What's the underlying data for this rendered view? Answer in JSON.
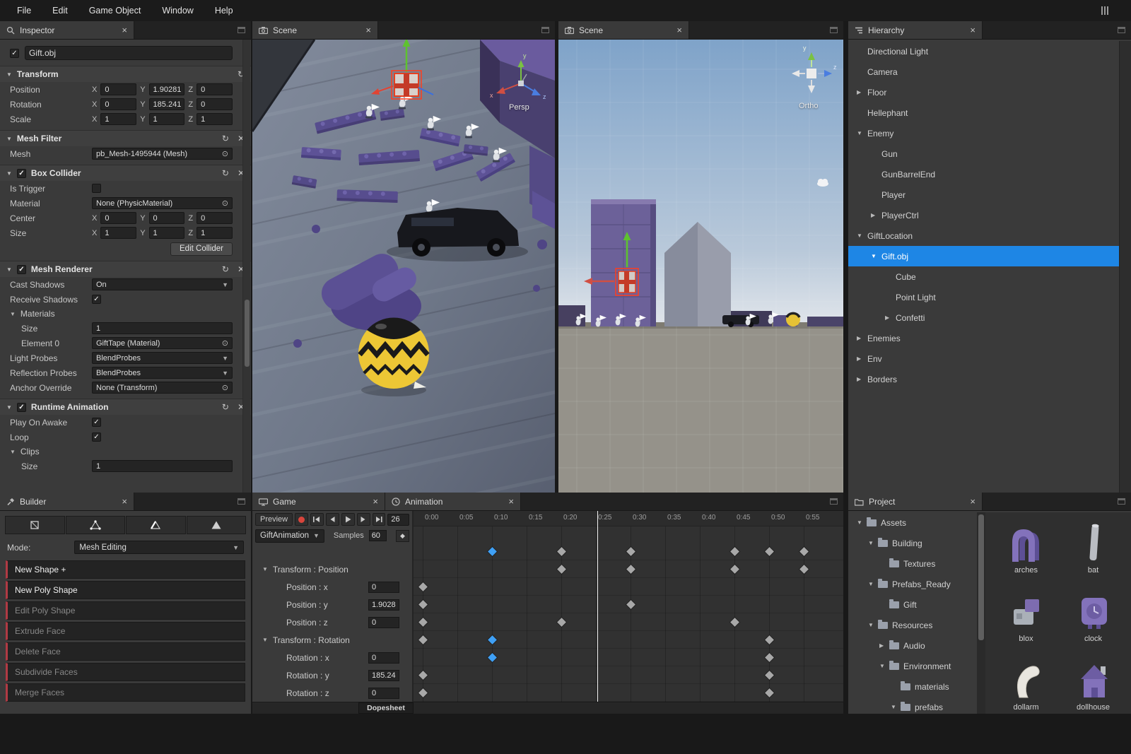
{
  "colors": {
    "accent_blue": "#1e86e5",
    "builder_red": "#b03a44",
    "record_red": "#d9453c",
    "keyframe_blue": "#3fa0f5",
    "panel_bg": "#3a3a3a"
  },
  "menubar": {
    "items": [
      "File",
      "Edit",
      "Game Object",
      "Window",
      "Help"
    ]
  },
  "inspector": {
    "tab": "Inspector",
    "name": "Gift.obj",
    "axes": {
      "x": "X",
      "y": "Y",
      "z": "Z"
    },
    "transform": {
      "title": "Transform",
      "position": "Position",
      "rotation": "Rotation",
      "scale": "Scale",
      "pos": {
        "x": "0",
        "y": "1.90281",
        "z": "0"
      },
      "rot": {
        "x": "0",
        "y": "185.241",
        "z": "0"
      },
      "scl": {
        "x": "1",
        "y": "1",
        "z": "1"
      }
    },
    "meshfilter": {
      "title": "Mesh Filter",
      "mesh": "Mesh",
      "mesh_value": "pb_Mesh-1495944 (Mesh)"
    },
    "boxcollider": {
      "title": "Box Collider",
      "is_trigger": "Is Trigger",
      "material": "Material",
      "material_value": "None (PhysicMaterial)",
      "center": "Center",
      "size": "Size",
      "center_v": {
        "x": "0",
        "y": "0",
        "z": "0"
      },
      "size_v": {
        "x": "1",
        "y": "1",
        "z": "1"
      },
      "edit": "Edit Collider"
    },
    "meshrenderer": {
      "title": "Mesh Renderer",
      "cast": "Cast Shadows",
      "cast_value": "On",
      "receive": "Receive Shadows",
      "materials": "Materials",
      "msize": "Size",
      "msize_value": "1",
      "el0": "Element 0",
      "el0_value": "GiftTape (Material)",
      "light": "Light Probes",
      "light_value": "BlendProbes",
      "refl": "Reflection Probes",
      "refl_value": "BlendProbes",
      "anchor": "Anchor Override",
      "anchor_value": "None (Transform)"
    },
    "runtimeanim": {
      "title": "Runtime Animation",
      "poa": "Play On Awake",
      "loop": "Loop",
      "clips": "Clips",
      "csize": "Size",
      "csize_value": "1"
    }
  },
  "scene1": {
    "tab": "Scene",
    "gizmo_label": "Persp",
    "axis_x": "x",
    "axis_y": "y",
    "axis_z": "z"
  },
  "scene2": {
    "tab": "Scene",
    "gizmo_label": "Ortho",
    "axis_y": "y",
    "axis_z": "z"
  },
  "hierarchy": {
    "tab": "Hierarchy",
    "items": [
      {
        "label": "Directional Light",
        "indent": 0,
        "arrow": ""
      },
      {
        "label": "Camera",
        "indent": 0,
        "arrow": ""
      },
      {
        "label": "Floor",
        "indent": 0,
        "arrow": "right"
      },
      {
        "label": "Hellephant",
        "indent": 0,
        "arrow": ""
      },
      {
        "label": "Enemy",
        "indent": 0,
        "arrow": "down"
      },
      {
        "label": "Gun",
        "indent": 1,
        "arrow": ""
      },
      {
        "label": "GunBarrelEnd",
        "indent": 1,
        "arrow": ""
      },
      {
        "label": "Player",
        "indent": 1,
        "arrow": ""
      },
      {
        "label": "PlayerCtrl",
        "indent": 1,
        "arrow": "right"
      },
      {
        "label": "GiftLocation",
        "indent": 0,
        "arrow": "down"
      },
      {
        "label": "Gift.obj",
        "indent": 1,
        "arrow": "down",
        "selected": true
      },
      {
        "label": "Cube",
        "indent": 2,
        "arrow": ""
      },
      {
        "label": "Point Light",
        "indent": 2,
        "arrow": ""
      },
      {
        "label": "Confetti",
        "indent": 2,
        "arrow": "right"
      },
      {
        "label": "Enemies",
        "indent": 0,
        "arrow": "right"
      },
      {
        "label": "Env",
        "indent": 0,
        "arrow": "right"
      },
      {
        "label": "Borders",
        "indent": 0,
        "arrow": "right"
      }
    ]
  },
  "builder": {
    "tab": "Builder",
    "mode_label": "Mode:",
    "mode_value": "Mesh Editing",
    "actions": [
      {
        "label": "New Shape  +",
        "enabled": true
      },
      {
        "label": "New Poly Shape",
        "enabled": true
      },
      {
        "label": "Edit Poly Shape",
        "enabled": false
      },
      {
        "label": "Extrude Face",
        "enabled": false
      },
      {
        "label": "Delete Face",
        "enabled": false
      },
      {
        "label": "Subdivide Faces",
        "enabled": false
      },
      {
        "label": "Merge Faces",
        "enabled": false
      }
    ]
  },
  "game": {
    "tab": "Game"
  },
  "animation": {
    "tab": "Animation",
    "preview_label": "Preview",
    "frame": "26",
    "clip_name": "GiftAnimation",
    "samples_label": "Samples",
    "samples_value": "60",
    "dopesheet_label": "Dopesheet",
    "properties": [
      {
        "label": "Transform : Position",
        "group": true
      },
      {
        "label": "Position : x",
        "value": "0"
      },
      {
        "label": "Position : y",
        "value": "1.9028"
      },
      {
        "label": "Position : z",
        "value": "0"
      },
      {
        "label": "Transform : Rotation",
        "group": true
      },
      {
        "label": "Rotation : x",
        "value": "0"
      },
      {
        "label": "Rotation : y",
        "value": "185.24"
      },
      {
        "label": "Rotation : z",
        "value": "0"
      }
    ],
    "ruler": [
      "0:00",
      "0:05",
      "0:10",
      "0:15",
      "0:20",
      "0:25",
      "0:30",
      "0:35",
      "0:40",
      "0:45",
      "0:50",
      "0:55"
    ],
    "playhead_seconds": 25.2,
    "tracks": [
      {
        "keys": [
          [
            10,
            1
          ],
          [
            20,
            0
          ],
          [
            30,
            0
          ],
          [
            45,
            0
          ],
          [
            50,
            0
          ],
          [
            55,
            0
          ]
        ]
      },
      {
        "keys": [
          [
            20,
            0
          ],
          [
            30,
            0
          ],
          [
            45,
            0
          ],
          [
            55,
            0
          ]
        ]
      },
      {
        "keys": [
          [
            0,
            0
          ]
        ]
      },
      {
        "keys": [
          [
            0,
            0
          ],
          [
            30,
            0
          ]
        ]
      },
      {
        "keys": [
          [
            0,
            0
          ],
          [
            20,
            0
          ],
          [
            45,
            0
          ]
        ]
      },
      {
        "keys": [
          [
            0,
            0
          ],
          [
            10,
            1
          ],
          [
            50,
            0
          ]
        ]
      },
      {
        "keys": [
          [
            10,
            1
          ],
          [
            50,
            0
          ]
        ]
      },
      {
        "keys": [
          [
            0,
            0
          ],
          [
            50,
            0
          ]
        ]
      },
      {
        "keys": [
          [
            0,
            0
          ],
          [
            50,
            0
          ]
        ]
      }
    ]
  },
  "project": {
    "tab": "Project",
    "tree": [
      {
        "label": "Assets",
        "indent": 0,
        "arrow": "down"
      },
      {
        "label": "Building",
        "indent": 1,
        "arrow": "down"
      },
      {
        "label": "Textures",
        "indent": 2,
        "arrow": ""
      },
      {
        "label": "Prefabs_Ready",
        "indent": 1,
        "arrow": "down"
      },
      {
        "label": "Gift",
        "indent": 2,
        "arrow": ""
      },
      {
        "label": "Resources",
        "indent": 1,
        "arrow": "down"
      },
      {
        "label": "Audio",
        "indent": 2,
        "arrow": "right"
      },
      {
        "label": "Environment",
        "indent": 2,
        "arrow": "down"
      },
      {
        "label": "materials",
        "indent": 3,
        "arrow": ""
      },
      {
        "label": "prefabs",
        "indent": 3,
        "arrow": "down"
      }
    ],
    "assets": [
      {
        "label": "arches"
      },
      {
        "label": "bat"
      },
      {
        "label": "blox"
      },
      {
        "label": "clock"
      },
      {
        "label": "dollarm"
      },
      {
        "label": "dollhouse"
      }
    ]
  }
}
